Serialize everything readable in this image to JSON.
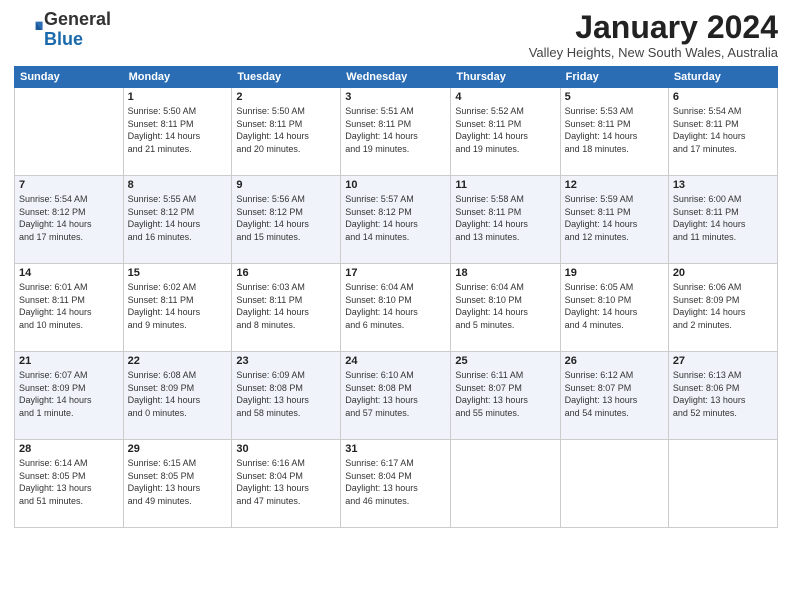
{
  "logo": {
    "general": "General",
    "blue": "Blue"
  },
  "header": {
    "month": "January 2024",
    "location": "Valley Heights, New South Wales, Australia"
  },
  "weekdays": [
    "Sunday",
    "Monday",
    "Tuesday",
    "Wednesday",
    "Thursday",
    "Friday",
    "Saturday"
  ],
  "weeks": [
    [
      {
        "day": "",
        "info": ""
      },
      {
        "day": "1",
        "info": "Sunrise: 5:50 AM\nSunset: 8:11 PM\nDaylight: 14 hours\nand 21 minutes."
      },
      {
        "day": "2",
        "info": "Sunrise: 5:50 AM\nSunset: 8:11 PM\nDaylight: 14 hours\nand 20 minutes."
      },
      {
        "day": "3",
        "info": "Sunrise: 5:51 AM\nSunset: 8:11 PM\nDaylight: 14 hours\nand 19 minutes."
      },
      {
        "day": "4",
        "info": "Sunrise: 5:52 AM\nSunset: 8:11 PM\nDaylight: 14 hours\nand 19 minutes."
      },
      {
        "day": "5",
        "info": "Sunrise: 5:53 AM\nSunset: 8:11 PM\nDaylight: 14 hours\nand 18 minutes."
      },
      {
        "day": "6",
        "info": "Sunrise: 5:54 AM\nSunset: 8:11 PM\nDaylight: 14 hours\nand 17 minutes."
      }
    ],
    [
      {
        "day": "7",
        "info": "Sunrise: 5:54 AM\nSunset: 8:12 PM\nDaylight: 14 hours\nand 17 minutes."
      },
      {
        "day": "8",
        "info": "Sunrise: 5:55 AM\nSunset: 8:12 PM\nDaylight: 14 hours\nand 16 minutes."
      },
      {
        "day": "9",
        "info": "Sunrise: 5:56 AM\nSunset: 8:12 PM\nDaylight: 14 hours\nand 15 minutes."
      },
      {
        "day": "10",
        "info": "Sunrise: 5:57 AM\nSunset: 8:12 PM\nDaylight: 14 hours\nand 14 minutes."
      },
      {
        "day": "11",
        "info": "Sunrise: 5:58 AM\nSunset: 8:11 PM\nDaylight: 14 hours\nand 13 minutes."
      },
      {
        "day": "12",
        "info": "Sunrise: 5:59 AM\nSunset: 8:11 PM\nDaylight: 14 hours\nand 12 minutes."
      },
      {
        "day": "13",
        "info": "Sunrise: 6:00 AM\nSunset: 8:11 PM\nDaylight: 14 hours\nand 11 minutes."
      }
    ],
    [
      {
        "day": "14",
        "info": "Sunrise: 6:01 AM\nSunset: 8:11 PM\nDaylight: 14 hours\nand 10 minutes."
      },
      {
        "day": "15",
        "info": "Sunrise: 6:02 AM\nSunset: 8:11 PM\nDaylight: 14 hours\nand 9 minutes."
      },
      {
        "day": "16",
        "info": "Sunrise: 6:03 AM\nSunset: 8:11 PM\nDaylight: 14 hours\nand 8 minutes."
      },
      {
        "day": "17",
        "info": "Sunrise: 6:04 AM\nSunset: 8:10 PM\nDaylight: 14 hours\nand 6 minutes."
      },
      {
        "day": "18",
        "info": "Sunrise: 6:04 AM\nSunset: 8:10 PM\nDaylight: 14 hours\nand 5 minutes."
      },
      {
        "day": "19",
        "info": "Sunrise: 6:05 AM\nSunset: 8:10 PM\nDaylight: 14 hours\nand 4 minutes."
      },
      {
        "day": "20",
        "info": "Sunrise: 6:06 AM\nSunset: 8:09 PM\nDaylight: 14 hours\nand 2 minutes."
      }
    ],
    [
      {
        "day": "21",
        "info": "Sunrise: 6:07 AM\nSunset: 8:09 PM\nDaylight: 14 hours\nand 1 minute."
      },
      {
        "day": "22",
        "info": "Sunrise: 6:08 AM\nSunset: 8:09 PM\nDaylight: 14 hours\nand 0 minutes."
      },
      {
        "day": "23",
        "info": "Sunrise: 6:09 AM\nSunset: 8:08 PM\nDaylight: 13 hours\nand 58 minutes."
      },
      {
        "day": "24",
        "info": "Sunrise: 6:10 AM\nSunset: 8:08 PM\nDaylight: 13 hours\nand 57 minutes."
      },
      {
        "day": "25",
        "info": "Sunrise: 6:11 AM\nSunset: 8:07 PM\nDaylight: 13 hours\nand 55 minutes."
      },
      {
        "day": "26",
        "info": "Sunrise: 6:12 AM\nSunset: 8:07 PM\nDaylight: 13 hours\nand 54 minutes."
      },
      {
        "day": "27",
        "info": "Sunrise: 6:13 AM\nSunset: 8:06 PM\nDaylight: 13 hours\nand 52 minutes."
      }
    ],
    [
      {
        "day": "28",
        "info": "Sunrise: 6:14 AM\nSunset: 8:05 PM\nDaylight: 13 hours\nand 51 minutes."
      },
      {
        "day": "29",
        "info": "Sunrise: 6:15 AM\nSunset: 8:05 PM\nDaylight: 13 hours\nand 49 minutes."
      },
      {
        "day": "30",
        "info": "Sunrise: 6:16 AM\nSunset: 8:04 PM\nDaylight: 13 hours\nand 47 minutes."
      },
      {
        "day": "31",
        "info": "Sunrise: 6:17 AM\nSunset: 8:04 PM\nDaylight: 13 hours\nand 46 minutes."
      },
      {
        "day": "",
        "info": ""
      },
      {
        "day": "",
        "info": ""
      },
      {
        "day": "",
        "info": ""
      }
    ]
  ]
}
